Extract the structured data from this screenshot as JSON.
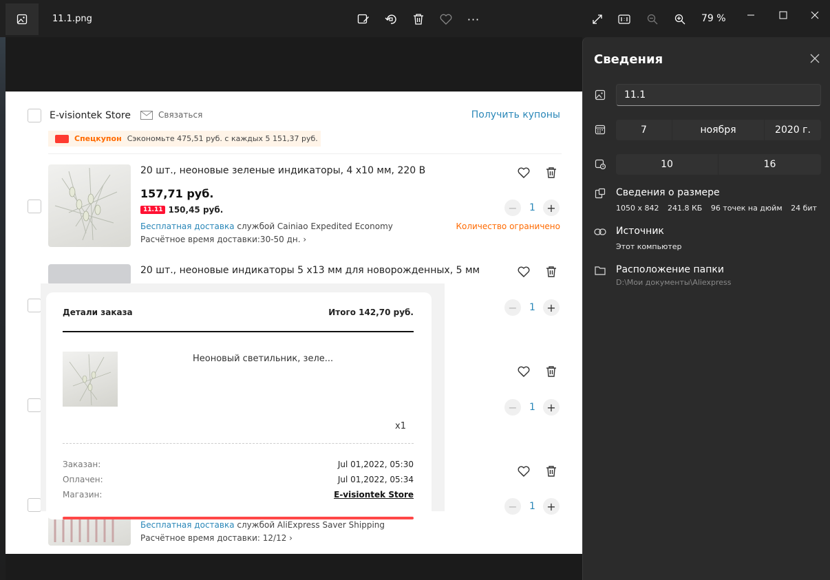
{
  "titlebar": {
    "file_name": "11.1.png",
    "zoom": "79 %",
    "actions": [
      "edit-image",
      "rotate",
      "delete",
      "favorite",
      "more"
    ],
    "more_label": "···"
  },
  "store": {
    "name": "E-visiontek Store",
    "contact_label": "Связаться",
    "coupons_link": "Получить купоны",
    "coupon_label": "Спецкупон",
    "coupon_text": "Сэкономьте 475,51 руб. с каждых 5 151,37 руб."
  },
  "products": [
    {
      "title": "20 шт., неоновые зеленые индикаторы, 4 x10 мм, 220 В",
      "price": "157,71 руб.",
      "promo_badge": "11.11",
      "promo_price": "150,45 руб.",
      "ship_free": "Бесплатная доставка",
      "ship_service": "службой Cainiao Expedited Economy",
      "eta": "Расчётное время доставки:30-50 дн.",
      "limited": "Количество ограничено",
      "qty": "1"
    },
    {
      "title": "20 шт., неоновые индикаторы 5 x13 мм для новорожденных, 5 мм",
      "qty": "1"
    },
    {
      "qty": "1"
    },
    {
      "ship_free": "Бесплатная доставка",
      "ship_service": "службой AliExpress Saver Shipping",
      "eta": "Расчётное время доставки: 12/12",
      "qty": "1"
    }
  ],
  "order_popup": {
    "title": "Детали заказа",
    "total": "Итого 142,70 руб.",
    "item_name": "Неоновый светильник, зеле...",
    "item_qty": "x1",
    "ordered_label": "Заказан:",
    "ordered_value": "Jul 01,2022, 05:30",
    "paid_label": "Оплачен:",
    "paid_value": "Jul 01,2022, 05:34",
    "store_label": "Магазин:",
    "store_value": "E-visiontek Store"
  },
  "info_panel": {
    "title": "Сведения",
    "file_name_value": "11.1",
    "date": {
      "day": "7",
      "month": "ноября",
      "year": "2020 г."
    },
    "time": {
      "hour": "10",
      "minute": "16"
    },
    "size_heading": "Сведения о размере",
    "dimensions": "1050 x 842",
    "file_size": "241.8 КБ",
    "dpi": "96 точек на дюйм",
    "bit_depth": "24 бит",
    "source_heading": "Источник",
    "source_value": "Этот компьютер",
    "folder_heading": "Расположение папки",
    "folder_path": "D:\\Мои документы\\Aliexpress"
  }
}
